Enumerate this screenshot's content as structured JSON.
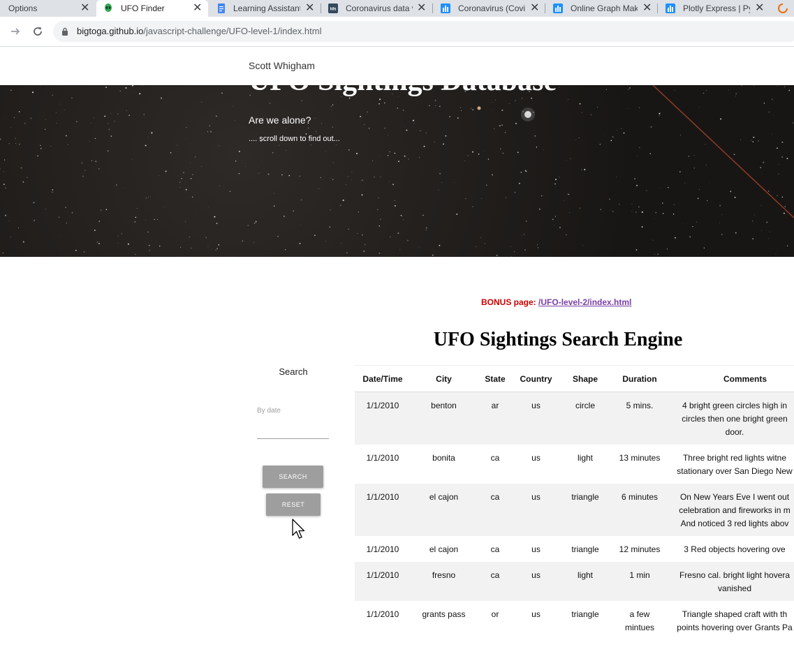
{
  "browser": {
    "tabs": [
      {
        "title": "Options"
      },
      {
        "title": "UFO Finder"
      },
      {
        "title": "Learning Assistant"
      },
      {
        "title": "Coronavirus data v"
      },
      {
        "title": "Coronavirus (Covi"
      },
      {
        "title": "Online Graph Mak"
      },
      {
        "title": "Plotly Express | Pyt"
      }
    ],
    "url_host": "bigtoga.github.io",
    "url_path": "/javascript-challenge/UFO-level-1/index.html"
  },
  "site": {
    "brand": "Scott Whigham",
    "hero_title": "UFO Sightings Database",
    "hero_subtitle": "Are we alone?",
    "hero_hint": ".... scroll down to find out...",
    "bonus_label": "BONUS page:",
    "bonus_link": "/UFO-level-2/index.html",
    "engine_title": "UFO Sightings Search Engine"
  },
  "filters": {
    "heading": "Search",
    "date_placeholder": "By date",
    "search_button": "Search",
    "reset_button": "Reset"
  },
  "table": {
    "headers": [
      "Date/Time",
      "City",
      "State",
      "Country",
      "Shape",
      "Duration",
      "Comments"
    ],
    "rows": [
      {
        "date": "1/1/2010",
        "city": "benton",
        "state": "ar",
        "country": "us",
        "shape": "circle",
        "duration": "5 mins.",
        "comments": [
          "4 bright green circles high in",
          "circles then one bright green",
          "door."
        ]
      },
      {
        "date": "1/1/2010",
        "city": "bonita",
        "state": "ca",
        "country": "us",
        "shape": "light",
        "duration": "13 minutes",
        "comments": [
          "Three bright red lights witne",
          "stationary over San Diego New"
        ]
      },
      {
        "date": "1/1/2010",
        "city": "el cajon",
        "state": "ca",
        "country": "us",
        "shape": "triangle",
        "duration": "6 minutes",
        "comments": [
          "On New Years Eve I went out",
          "celebration and fireworks in m",
          "And noticed 3 red lights abov"
        ]
      },
      {
        "date": "1/1/2010",
        "city": "el cajon",
        "state": "ca",
        "country": "us",
        "shape": "triangle",
        "duration": "12 minutes",
        "comments": [
          "3 Red objects hovering ove"
        ]
      },
      {
        "date": "1/1/2010",
        "city": "fresno",
        "state": "ca",
        "country": "us",
        "shape": "light",
        "duration": "1 min",
        "comments": [
          "Fresno cal. bright light hovera",
          "vanished"
        ]
      },
      {
        "date": "1/1/2010",
        "city": "grants pass",
        "state": "or",
        "country": "us",
        "shape": "triangle",
        "duration": "a few mintues",
        "comments": [
          "Triangle shaped craft with th",
          "points hovering over Grants Pa"
        ]
      }
    ]
  },
  "colors": {
    "bonus_label": "#cc0000",
    "bonus_link": "#7b3ea8",
    "button_bg": "#9e9e9e",
    "row_stripe": "#f2f2f2"
  }
}
